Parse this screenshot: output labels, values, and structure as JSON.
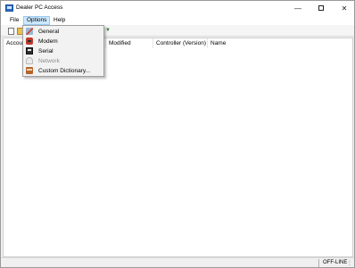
{
  "window": {
    "title": "Dealer PC Access"
  },
  "menubar": {
    "file": "File",
    "options": "Options",
    "help": "Help"
  },
  "options_menu": {
    "items": [
      {
        "label": "General",
        "icon": "wrench-icon",
        "enabled": true
      },
      {
        "label": "Modem",
        "icon": "modem-icon",
        "enabled": true
      },
      {
        "label": "Serial",
        "icon": "serial-port-icon",
        "enabled": true
      },
      {
        "label": "Network",
        "icon": "network-icon",
        "enabled": false
      },
      {
        "label": "Custom Dictionary...",
        "icon": "dictionary-icon",
        "enabled": true
      }
    ]
  },
  "listview": {
    "columns": [
      "Account",
      "Modified",
      "Controller (Version)",
      "Name"
    ]
  },
  "statusbar": {
    "connection": "OFF-LINE"
  },
  "colors": {
    "menu_highlight": "#cce8ff",
    "app_icon": "#2b6fc4"
  }
}
